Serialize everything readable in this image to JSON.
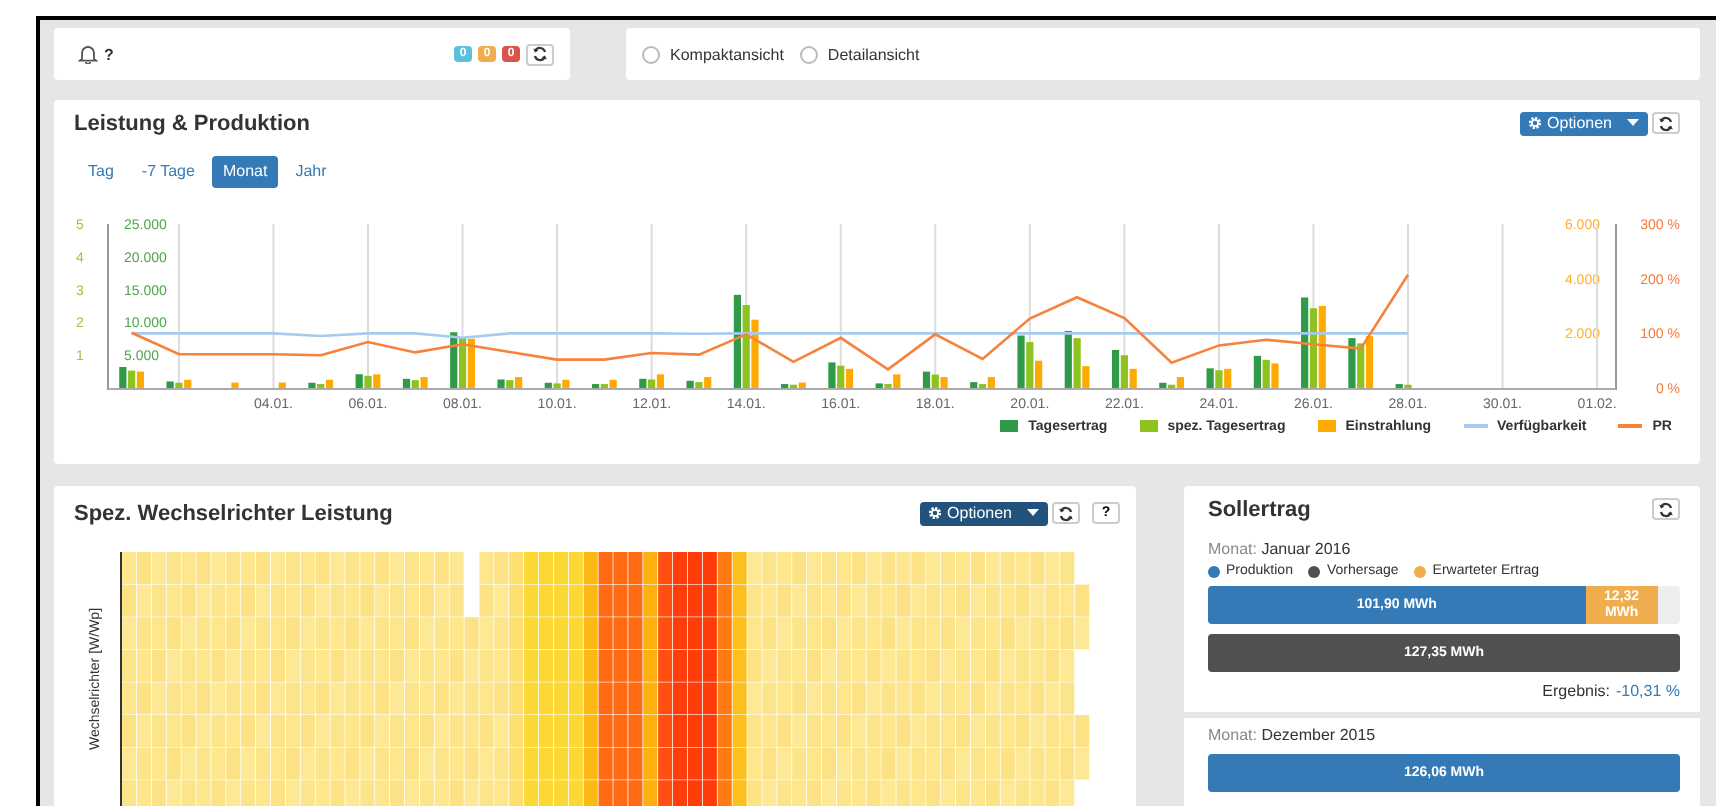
{
  "notifications": {
    "help": "?",
    "badges": [
      {
        "text": "0",
        "color": "#5bc0de"
      },
      {
        "text": "0",
        "color": "#f0ad4e"
      },
      {
        "text": "0",
        "color": "#d9534f"
      }
    ]
  },
  "view_options": [
    {
      "label": "Kompaktansicht",
      "selected": false
    },
    {
      "label": "Detailansicht",
      "selected": false
    }
  ],
  "performance_panel": {
    "title": "Leistung & Produktion",
    "options_button": "Optionen",
    "tabs": [
      {
        "label": "Tag",
        "selected": false
      },
      {
        "label": "-7 Tage",
        "selected": false
      },
      {
        "label": "Monat",
        "selected": true
      },
      {
        "label": "Jahr",
        "selected": false
      }
    ],
    "charts": [
      {
        "chart_data": {
          "type": "bar",
          "stacked": false,
          "grid": true,
          "categories": [
            null,
            null,
            null,
            "04.01.",
            null,
            "06.01.",
            null,
            "08.01.",
            null,
            "10.01.",
            null,
            "12.01.",
            null,
            "14.01.",
            null,
            "16.01.",
            null,
            "18.01.",
            null,
            "20.01.",
            null,
            "22.01.",
            null,
            "24.01.",
            null,
            "26.01.",
            null,
            "28.01.",
            null,
            "30.01.",
            null,
            "01.02."
          ],
          "ylim": [
            0,
            25000
          ],
          "yticks": [
            {
              "value": 5000,
              "label": "5.000"
            },
            {
              "value": 10000,
              "label": "10.000"
            },
            {
              "value": 15000,
              "label": "15.000"
            },
            {
              "value": 20000,
              "label": "20.000"
            },
            {
              "value": 25000,
              "label": "25.000"
            }
          ],
          "y2lim": [
            0,
            5
          ],
          "y2ticks": [
            1,
            2,
            3,
            4,
            5
          ],
          "y3lim": [
            0,
            6000
          ],
          "y3ticks": [
            {
              "value": 2000,
              "label": "2.000"
            },
            {
              "value": 4000,
              "label": "4.000"
            },
            {
              "value": 6000,
              "label": "6.000"
            }
          ],
          "series": [
            {
              "name": "Tagesertrag",
              "color": "#2f9a47",
              "values": [
                3200,
                1000,
                0,
                0,
                800,
                2100,
                1400,
                8500,
                1300,
                800,
                600,
                1400,
                1100,
                14200,
                600,
                3900,
                700,
                2500,
                900,
                8000,
                8700,
                5800,
                800,
                3000,
                4900,
                13800,
                7600,
                600,
                null,
                null,
                null,
                null
              ]
            },
            {
              "name": "spez. Tagesertrag",
              "color": "#8dc21f",
              "axis": "y2",
              "values": [
                0.53,
                0.16,
                0,
                0,
                0.12,
                0.37,
                0.24,
                1.52,
                0.24,
                0.14,
                0.12,
                0.26,
                0.18,
                2.53,
                0.1,
                0.68,
                0.12,
                0.41,
                0.12,
                1.4,
                1.52,
                1.0,
                0.1,
                0.54,
                0.86,
                2.43,
                1.36,
                0.1,
                null,
                null,
                null,
                null
              ]
            },
            {
              "name": "Einstrahlung",
              "color": "#ffaa00",
              "axis": "y3",
              "values": [
                600,
                300,
                200,
                200,
                300,
                500,
                400,
                1800,
                400,
                300,
                300,
                500,
                400,
                2500,
                200,
                700,
                500,
                400,
                400,
                1000,
                800,
                700,
                400,
                700,
                900,
                3000,
                1900,
                0,
                null,
                null,
                null,
                null
              ]
            }
          ]
        }
      },
      {
        "chart_data": {
          "type": "line",
          "categories": [
            null,
            null,
            null,
            null,
            null,
            null,
            null,
            null,
            null,
            null,
            null,
            null,
            null,
            null,
            null,
            null,
            null,
            null,
            null,
            null,
            null,
            null,
            null,
            null,
            null,
            null,
            null,
            null,
            null,
            null,
            null,
            null
          ],
          "ylim": [
            0,
            300
          ],
          "yticks": [
            {
              "value": 0,
              "label": "0 %"
            },
            {
              "value": 100,
              "label": "100 %"
            },
            {
              "value": 200,
              "label": "200 %"
            },
            {
              "value": 300,
              "label": "300 %"
            }
          ],
          "series": [
            {
              "name": "Verfügbarkeit",
              "color": "#a6cbef",
              "values": [
                100,
                100,
                100,
                100,
                95,
                100,
                100,
                92,
                100,
                100,
                100,
                100,
                99,
                100,
                100,
                100,
                100,
                100,
                100,
                100,
                100,
                100,
                100,
                100,
                100,
                100,
                100,
                100,
                null,
                null,
                null,
                null
              ]
            },
            {
              "name": "PR",
              "color": "#f6823c",
              "values": [
                101,
                62,
                62,
                62,
                60,
                84,
                65,
                80,
                66,
                52,
                52,
                64,
                61,
                98,
                48,
                92,
                34,
                98,
                53,
                127,
                166,
                128,
                46,
                78,
                88,
                80,
                72,
                207,
                null,
                null,
                null,
                null
              ]
            }
          ]
        }
      }
    ]
  },
  "inverter_panel": {
    "title": "Spez. Wechselrichter Leistung",
    "options_button": "Optionen",
    "help_button": "?",
    "y_axis_label": "Wechselrichter [W/Wp]"
  },
  "target_panel": {
    "title": "Sollertrag",
    "months": [
      {
        "label": "Monat:",
        "month": "Januar 2016",
        "legend": [
          {
            "label": "Produktion",
            "color": "#337ab7"
          },
          {
            "label": "Vorhersage",
            "color": "#505050"
          },
          {
            "label": "Erwarteter Ertrag",
            "color": "#f0ad4e"
          }
        ],
        "bars": [
          {
            "kind": "stacked",
            "segments": [
              {
                "text": "101,90 MWh",
                "level": 0.8,
                "color": "#337ab7"
              },
              {
                "text": "12,32 MWh",
                "color": "#f0ad4e"
              }
            ]
          },
          {
            "kind": "full",
            "text": "127,35 MWh",
            "color": "#505050"
          }
        ],
        "result_label": "Ergebnis:",
        "result_value": "-10,31 %"
      },
      {
        "label": "Monat:",
        "month": "Dezember 2015",
        "bars": [
          {
            "kind": "full",
            "text": "126,06 MWh",
            "color": "#337ab7"
          }
        ]
      }
    ]
  }
}
